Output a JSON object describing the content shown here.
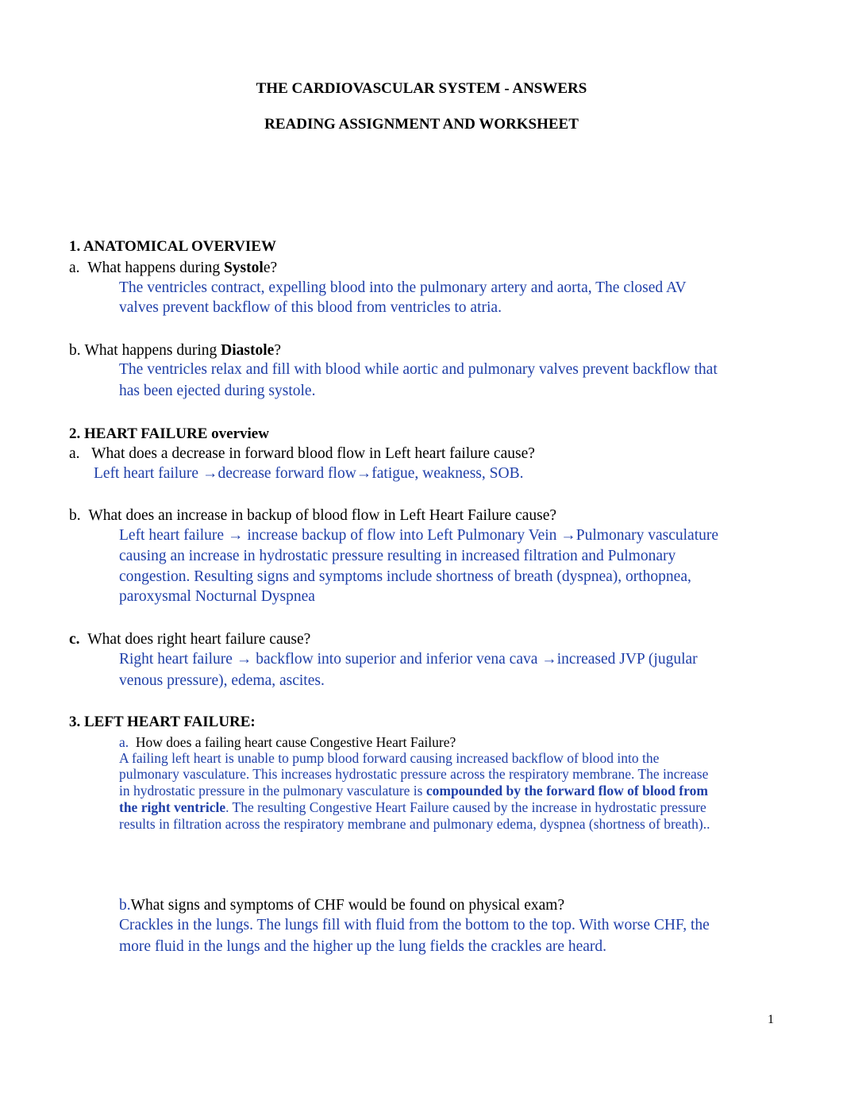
{
  "header": {
    "title": "THE CARDIOVASCULAR SYSTEM - ANSWERS",
    "subtitle": "READING ASSIGNMENT AND WORKSHEET"
  },
  "sections": [
    {
      "heading": "1.  ANATOMICAL OVERVIEW",
      "questions": [
        {
          "label": "a.",
          "text_before": "What happens during ",
          "bold": "Systol",
          "text_after": "e?",
          "answer_lines": [
            "The ventricles contract, expelling blood into the pulmonary artery and aorta,  The closed AV",
            "valves prevent backflow of this blood from ventricles to atria."
          ]
        },
        {
          "label": "b.",
          "text_before": "What happens during ",
          "bold": "Diastole",
          "text_after": "?",
          "answer_lines": [
            "The ventricles relax and fill with blood while aortic and pulmonary valves prevent backflow that",
            "has been ejected during systole."
          ]
        }
      ]
    },
    {
      "heading_bold": "2.  HEART FAILURE",
      "heading_rest": " overview",
      "questions": [
        {
          "label": "a.",
          "text": "What does a decrease in forward blood flow in Left heart failure cause?",
          "answer_lines": [
            "Left heart failure →decrease forward flow→fatigue, weakness, SOB."
          ]
        },
        {
          "label": "b.",
          "text": "What does an increase in backup of blood flow in Left Heart Failure cause?",
          "answer_lines": [
            "Left heart failure → increase backup of flow into Left Pulmonary Vein →Pulmonary vasculature",
            "causing an increase in hydrostatic pressure resulting in increased filtration and Pulmonary",
            "congestion.  Resulting signs and symptoms include shortness of breath (dyspnea), orthopnea,",
            "paroxysmal Nocturnal Dyspnea"
          ]
        },
        {
          "label": "c.",
          "text": "What does right heart failure cause?",
          "answer_lines": [
            "Right heart failure → backflow into superior and inferior vena cava →increased JVP (jugular",
            "venous pressure), edema, ascites."
          ]
        }
      ]
    },
    {
      "heading": "3.  LEFT HEART FAILURE:",
      "questions": [
        {
          "label": "a.",
          "text": "How does a failing heart cause Congestive Heart Failure?",
          "answer": {
            "line1": "A failing left heart is unable to pump blood forward causing increased backflow of blood into the",
            "line2": "pulmonary vasculature.  This increases hydrostatic pressure across the respiratory membrane.   The increase",
            "line3_plain": "in hydrostatic pressure in the pulmonary vasculature is ",
            "line3_bold": "compounded by the forward flow of blood from",
            "line4_bold": "the right ventricle",
            "line4_plain": ". The resulting Congestive Heart Failure caused by the increase in hydrostatic pressure",
            "line5": "results in filtration across the respiratory membrane and pulmonary edema, dyspnea (shortness of breath).."
          }
        },
        {
          "label": "b.",
          "text": "What signs and symptoms of CHF would be found on physical exam?",
          "answer_lines": [
            "Crackles in the lungs.  The lungs fill with fluid from the bottom to the top. With worse CHF, the",
            "more fluid in the lungs and the higher up the lung fields the crackles are heard."
          ]
        }
      ]
    }
  ],
  "footer": {
    "page_number": "1"
  }
}
